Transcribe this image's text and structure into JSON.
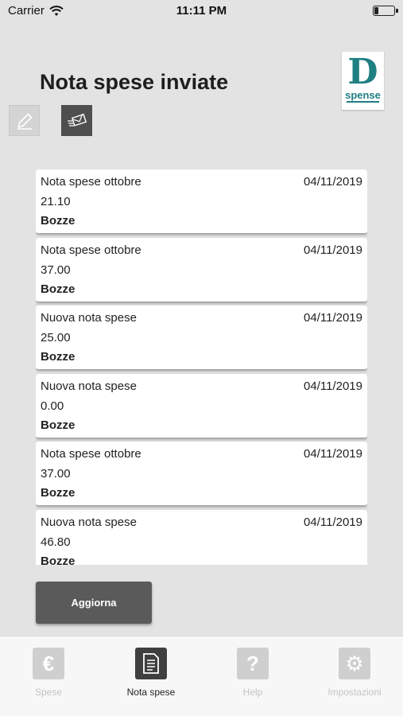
{
  "status_bar": {
    "carrier": "Carrier",
    "time": "11:11 PM",
    "battery_level": 0.2
  },
  "header": {
    "title": "Nota spese inviate",
    "logo_letter": "D",
    "logo_word": "spense"
  },
  "toolbar": {
    "edit_icon": "pencil-icon",
    "send_icon": "send-envelope-icon"
  },
  "expense_reports": [
    {
      "title": "Nota spese ottobre",
      "date": "04/11/2019",
      "amount": "21.10",
      "status": "Bozze"
    },
    {
      "title": "Nota spese ottobre",
      "date": "04/11/2019",
      "amount": "37.00",
      "status": "Bozze"
    },
    {
      "title": "Nuova nota spese",
      "date": "04/11/2019",
      "amount": "25.00",
      "status": "Bozze"
    },
    {
      "title": "Nuova nota spese",
      "date": "04/11/2019",
      "amount": "0.00",
      "status": "Bozze"
    },
    {
      "title": "Nota spese ottobre",
      "date": "04/11/2019",
      "amount": "37.00",
      "status": "Bozze"
    },
    {
      "title": "Nuova nota spese",
      "date": "04/11/2019",
      "amount": "46.80",
      "status": "Bozze"
    }
  ],
  "actions": {
    "refresh_label": "Aggiorna"
  },
  "tab_bar": {
    "tabs": [
      {
        "label": "Spese",
        "icon": "euro-icon",
        "glyph": "€",
        "active": false
      },
      {
        "label": "Nota spese",
        "icon": "document-icon",
        "glyph": "",
        "active": true
      },
      {
        "label": "Help",
        "icon": "help-icon",
        "glyph": "?",
        "active": false
      },
      {
        "label": "Impostazioni",
        "icon": "gear-icon",
        "glyph": "⚙",
        "active": false
      }
    ]
  },
  "colors": {
    "background": "#e3e3e3",
    "brand": "#1f7f83",
    "button": "#5a5a5a",
    "active_tab": "#3f3f3f"
  }
}
